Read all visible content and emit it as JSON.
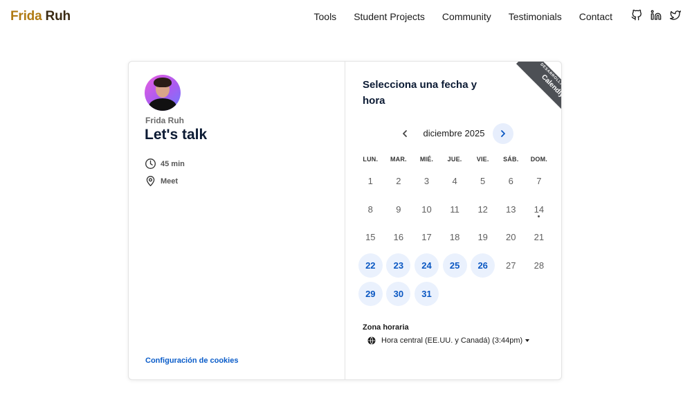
{
  "brand": {
    "first": "Frida",
    "last": "Ruh"
  },
  "nav": {
    "items": [
      {
        "label": "Tools"
      },
      {
        "label": "Student Projects"
      },
      {
        "label": "Community"
      },
      {
        "label": "Testimonials"
      },
      {
        "label": "Contact"
      }
    ]
  },
  "social_icons": [
    "github-icon",
    "linkedin-icon",
    "twitter-icon"
  ],
  "event": {
    "host": "Frida Ruh",
    "title": "Let's talk",
    "duration": "45 min",
    "location": "Meet",
    "cookies_link": "Configuración de cookies"
  },
  "calendar": {
    "heading": "Selecciona una fecha y hora",
    "month": "diciembre 2025",
    "weekdays": [
      "LUN.",
      "MAR.",
      "MIÉ.",
      "JUE.",
      "VIE.",
      "SÁB.",
      "DOM."
    ],
    "days": [
      "1",
      "2",
      "3",
      "4",
      "5",
      "6",
      "7",
      "8",
      "9",
      "10",
      "11",
      "12",
      "13",
      "14",
      "15",
      "16",
      "17",
      "18",
      "19",
      "20",
      "21",
      "22",
      "23",
      "24",
      "25",
      "26",
      "27",
      "28",
      "29",
      "30",
      "31"
    ],
    "available_days": [
      "22",
      "23",
      "24",
      "25",
      "26",
      "29",
      "30",
      "31"
    ],
    "today": "14"
  },
  "timezone": {
    "label": "Zona horaria",
    "value": "Hora central (EE.UU. y Canadá) (3:44pm)"
  },
  "ribbon": {
    "line1": "DESARROLLADO POR",
    "line2": "Calendly"
  },
  "colors": {
    "accent": "#0a57c2",
    "available_bg": "#eaf1fd",
    "brand_first": "#b07a12",
    "brand_last": "#3a2a12",
    "ribbon_bg": "#4d5055"
  }
}
